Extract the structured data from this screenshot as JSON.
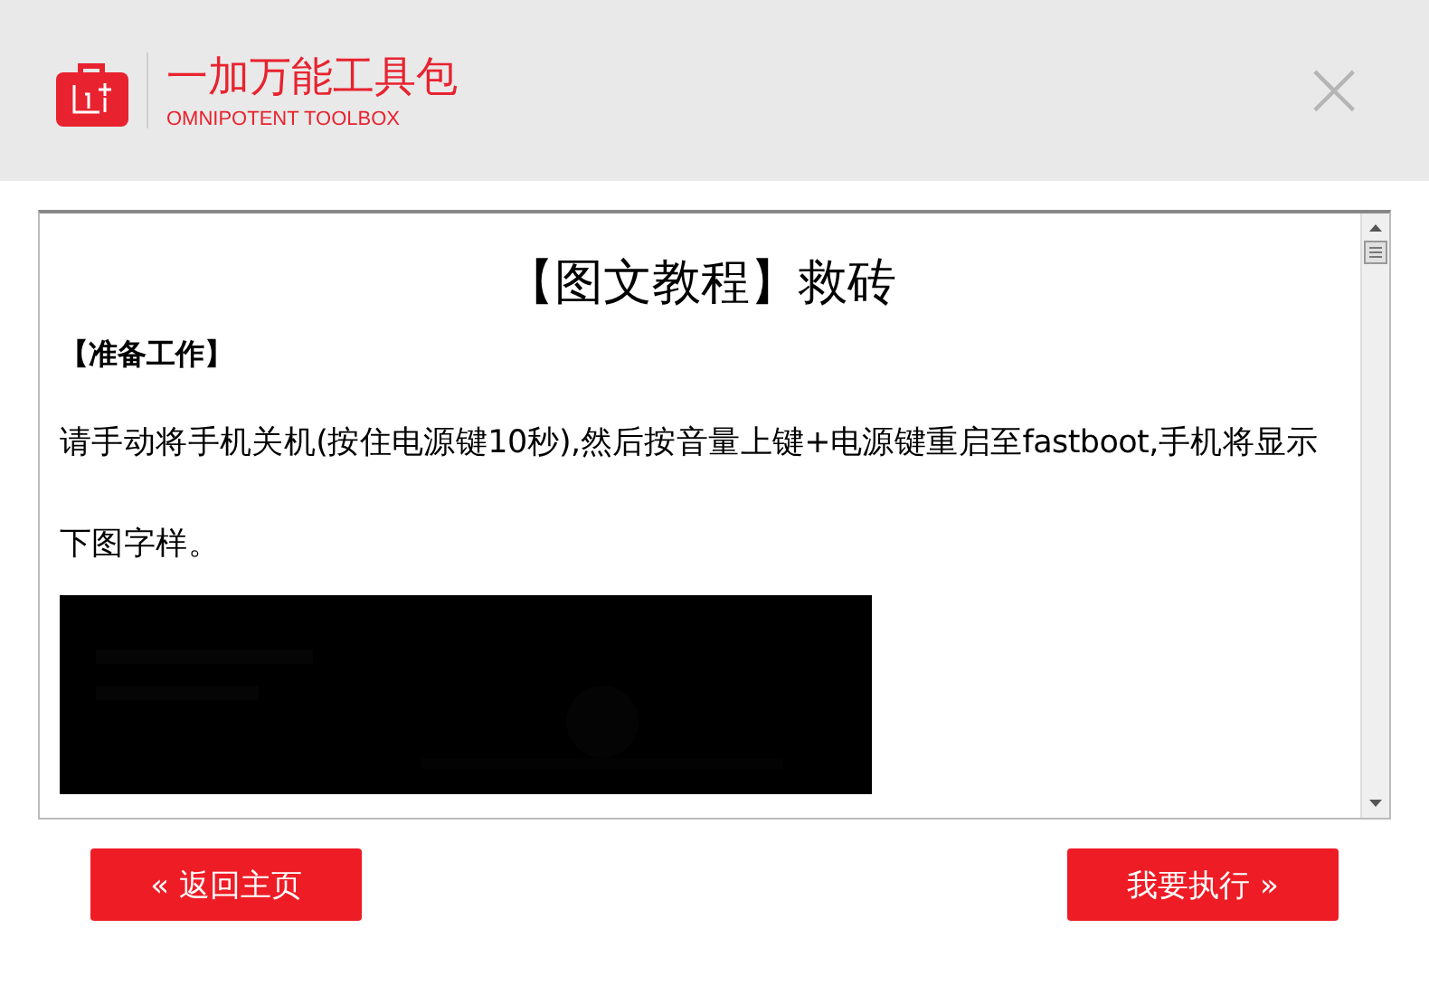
{
  "header": {
    "title": "一加万能工具包",
    "subtitle": "OMNIPOTENT TOOLBOX",
    "close": "×"
  },
  "article": {
    "heading": "【图文教程】救砖",
    "section": "【准备工作】",
    "paragraph": "请手动将手机关机(按住电源键10秒),然后按音量上键+电源键重启至fastboot,手机将显示下图字样。"
  },
  "buttons": [
    {
      "label": "« 返回主页"
    },
    {
      "label": "我要执行 »"
    }
  ]
}
